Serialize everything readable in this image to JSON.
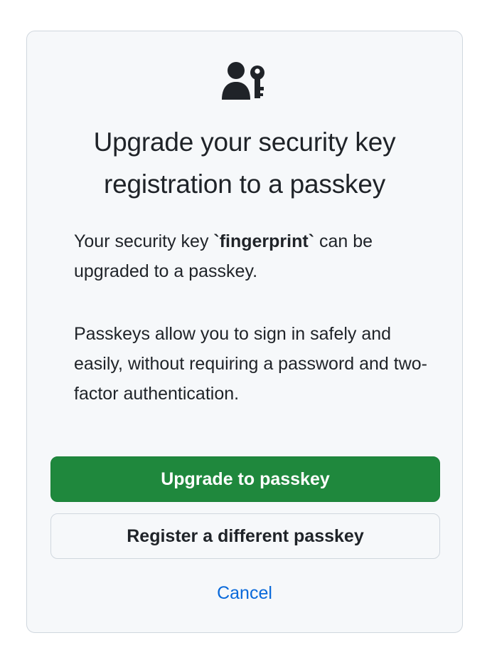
{
  "card": {
    "icon": "passkey-person-key-icon",
    "title": "Upgrade your security key registration to a passkey",
    "paragraph1": {
      "before": "Your security key ",
      "key_name": "`fingerprint`",
      "after": " can be upgraded to a passkey."
    },
    "paragraph2": "Passkeys allow you to sign in safely and easily, without requiring a password and two-factor authentication.",
    "primary_button": "Upgrade to passkey",
    "secondary_button": "Register a different passkey",
    "cancel_link": "Cancel"
  },
  "colors": {
    "primary": "#1f883d",
    "link": "#0969da",
    "card_background": "#f6f8fa",
    "border": "#d0d7de"
  }
}
